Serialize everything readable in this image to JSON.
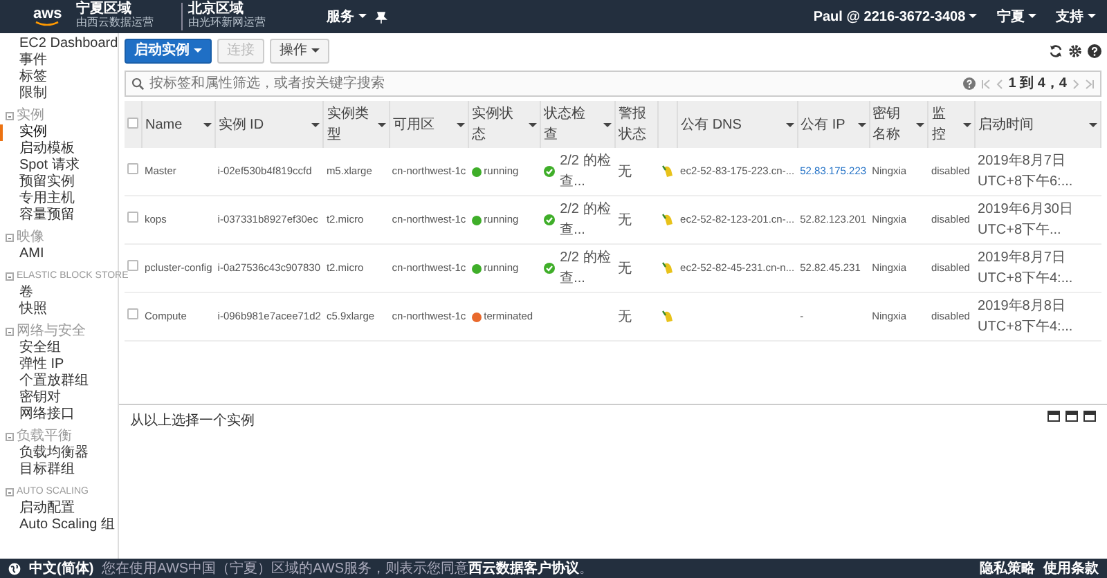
{
  "topbar": {
    "logo": "aws",
    "regions": [
      {
        "name": "宁夏区域",
        "operator": "由西云数据运营"
      },
      {
        "name": "北京区域",
        "operator": "由光环新网运营"
      }
    ],
    "services": "服务",
    "account": "Paul @ 2216-3672-3408",
    "region": "宁夏",
    "support": "支持"
  },
  "sidebar": {
    "items": [
      {
        "label": "EC2 Dashboard",
        "selected": false
      },
      {
        "label": "事件",
        "selected": false
      },
      {
        "label": "标签",
        "selected": false
      },
      {
        "label": "限制",
        "selected": false
      }
    ],
    "sections": [
      {
        "title": "实例",
        "items": [
          {
            "label": "实例",
            "selected": true
          },
          {
            "label": "启动模板",
            "selected": false
          },
          {
            "label": "Spot 请求",
            "selected": false
          },
          {
            "label": "预留实例",
            "selected": false
          },
          {
            "label": "专用主机",
            "selected": false
          },
          {
            "label": "容量预留",
            "selected": false
          }
        ]
      },
      {
        "title": "映像",
        "items": [
          {
            "label": "AMI",
            "selected": false
          }
        ]
      },
      {
        "title": "ELASTIC BLOCK STORE",
        "items": [
          {
            "label": "卷",
            "selected": false
          },
          {
            "label": "快照",
            "selected": false
          }
        ]
      },
      {
        "title": "网络与安全",
        "items": [
          {
            "label": "安全组",
            "selected": false
          },
          {
            "label": "弹性 IP",
            "selected": false
          },
          {
            "label": "个置放群组",
            "selected": false
          },
          {
            "label": "密钥对",
            "selected": false
          },
          {
            "label": "网络接口",
            "selected": false
          }
        ]
      },
      {
        "title": "负载平衡",
        "items": [
          {
            "label": "负载均衡器",
            "selected": false
          },
          {
            "label": "目标群组",
            "selected": false
          }
        ]
      },
      {
        "title": "AUTO SCALING",
        "items": [
          {
            "label": "启动配置",
            "selected": false
          },
          {
            "label": "Auto Scaling 组",
            "selected": false
          }
        ]
      }
    ]
  },
  "toolbar": {
    "launch_button": "启动实例",
    "connect_button": "连接",
    "connect_disabled": true,
    "actions_button": "操作"
  },
  "search": {
    "placeholder": "按标签和属性筛选，或者按关键字搜索",
    "pagination": "1 到 4，4"
  },
  "table": {
    "select_all_checked": false,
    "columns": [
      "Name",
      "实例 ID",
      "实例类型",
      "可用区",
      "实例状态",
      "状态检查",
      "警报状态",
      "公有 DNS",
      "公有 IP",
      "密钥名称",
      "监控",
      "启动时间"
    ],
    "rows": [
      {
        "checked": false,
        "name": "Master",
        "id": "i-02ef530b4f819ccfd",
        "type": "m5.xlarge",
        "zone": "cn-northwest-1c",
        "state": "running",
        "color": "#3fae29",
        "check": "2/2 的检查...",
        "alarm": "无",
        "dns": "ec2-52-83-175-223.cn-...",
        "ip": "52.83.175.223",
        "ip_link": true,
        "key": "Ningxia",
        "monitoring": "disabled",
        "launch_time": "2019年8月7日 UTC+8下午6:..."
      },
      {
        "checked": false,
        "name": "kops",
        "id": "i-037331b8927ef30ec",
        "type": "t2.micro",
        "zone": "cn-northwest-1c",
        "state": "running",
        "color": "#3fae29",
        "check": "2/2 的检查...",
        "alarm": "无",
        "dns": "ec2-52-82-123-201.cn-...",
        "ip": "52.82.123.201",
        "ip_link": false,
        "key": "Ningxia",
        "monitoring": "disabled",
        "launch_time": "2019年6月30日 UTC+8下午..."
      },
      {
        "checked": false,
        "name": "pcluster-config",
        "id": "i-0a27536c43c907830",
        "type": "t2.micro",
        "zone": "cn-northwest-1c",
        "state": "running",
        "color": "#3fae29",
        "check": "2/2 的检查...",
        "alarm": "无",
        "dns": "ec2-52-82-45-231.cn-n...",
        "ip": "52.82.45.231",
        "ip_link": false,
        "key": "Ningxia",
        "monitoring": "disabled",
        "launch_time": "2019年8月7日 UTC+8下午4:..."
      },
      {
        "checked": false,
        "name": "Compute",
        "id": "i-096b981e7acee71d2",
        "type": "c5.9xlarge",
        "zone": "cn-northwest-1c",
        "state": "terminated",
        "color": "#e9692c",
        "check": "",
        "alarm": "无",
        "dns": "",
        "ip": "-",
        "ip_link": false,
        "key": "Ningxia",
        "monitoring": "disabled",
        "launch_time": "2019年8月8日 UTC+8下午4:..."
      }
    ]
  },
  "detail_pane": {
    "message": "从以上选择一个实例"
  },
  "footer": {
    "language": "中文(简体)",
    "notice": "您在使用AWS中国（宁夏）区域的AWS服务，则表示您同意**西云数据客户协议**。",
    "links": [
      "隐私策略",
      "使用条款"
    ]
  }
}
